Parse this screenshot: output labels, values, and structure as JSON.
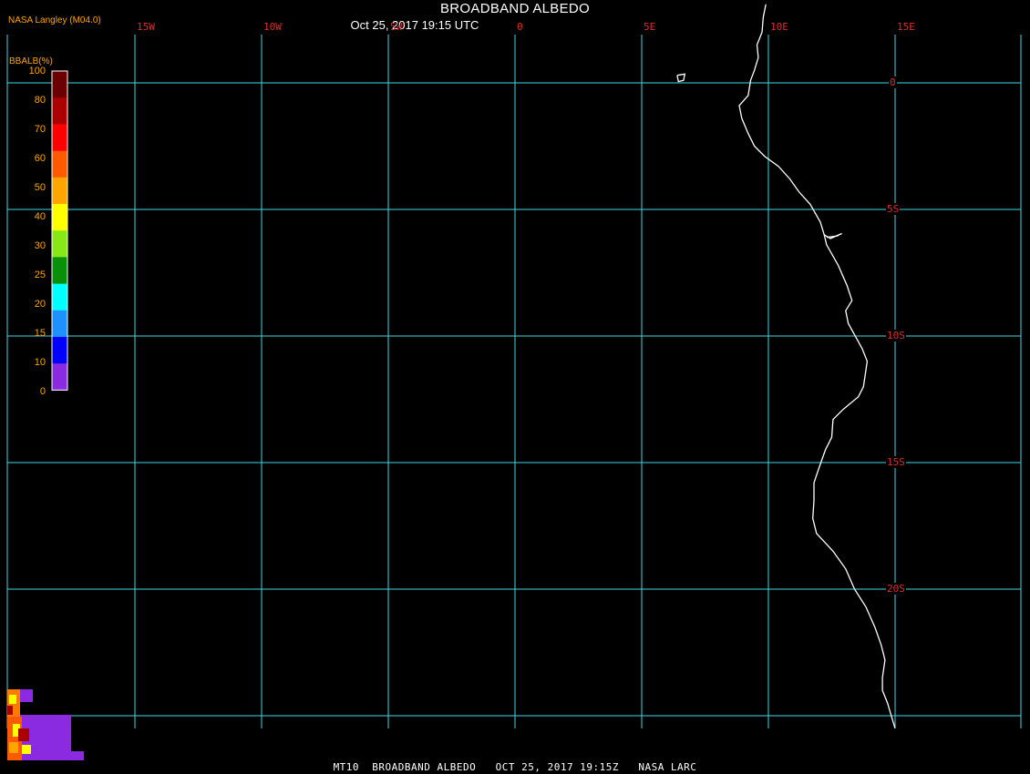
{
  "header": {
    "title": "BROADBAND ALBEDO",
    "datetime": "Oct 25, 2017 19:15 UTC",
    "credit": "NASA Langley (M04.0)"
  },
  "colorbar": {
    "title": "BBALB(%)",
    "ticks": [
      "100",
      "80",
      "70",
      "60",
      "50",
      "40",
      "30",
      "25",
      "20",
      "15",
      "10",
      "0"
    ],
    "colors": [
      "#6a0000",
      "#aa0000",
      "#ff0000",
      "#ff5a00",
      "#ffa500",
      "#ffff00",
      "#88e817",
      "#0a8f0a",
      "#00ffff",
      "#1e90ff",
      "#0000ff",
      "#8a2be2"
    ]
  },
  "grid": {
    "longitudes": [
      {
        "label": "15W",
        "lon": -15
      },
      {
        "label": "10W",
        "lon": -10
      },
      {
        "label": "5W",
        "lon": -5
      },
      {
        "label": "0",
        "lon": 0
      },
      {
        "label": "5E",
        "lon": 5
      },
      {
        "label": "10E",
        "lon": 10
      },
      {
        "label": "15E",
        "lon": 15
      }
    ],
    "latitudes": [
      {
        "label": "0",
        "lat": 0
      },
      {
        "label": "5S",
        "lat": -5
      },
      {
        "label": "10S",
        "lat": -10
      },
      {
        "label": "15S",
        "lat": -15
      },
      {
        "label": "20S",
        "lat": -20
      },
      {
        "label": "",
        "lat": -25
      }
    ],
    "line_color": "#40d8e0",
    "label_color": "#e02a2a"
  },
  "map": {
    "coastline_color": "#ffffff",
    "coastline": [
      [
        9.9,
        3.1
      ],
      [
        9.8,
        2.6
      ],
      [
        9.75,
        2.0
      ],
      [
        9.55,
        1.5
      ],
      [
        9.6,
        1.0
      ],
      [
        9.45,
        0.5
      ],
      [
        9.3,
        0.1
      ],
      [
        9.2,
        -0.5
      ],
      [
        8.85,
        -0.9
      ],
      [
        8.95,
        -1.4
      ],
      [
        9.2,
        -2.0
      ],
      [
        9.45,
        -2.5
      ],
      [
        9.85,
        -2.9
      ],
      [
        10.4,
        -3.3
      ],
      [
        10.85,
        -3.8
      ],
      [
        11.2,
        -4.3
      ],
      [
        11.65,
        -4.8
      ],
      [
        12.05,
        -5.5
      ],
      [
        12.2,
        -6.0
      ],
      [
        12.3,
        -6.4
      ],
      [
        12.75,
        -7.2
      ],
      [
        13.1,
        -8.0
      ],
      [
        13.3,
        -8.6
      ],
      [
        13.05,
        -9.0
      ],
      [
        13.15,
        -9.5
      ],
      [
        13.7,
        -10.5
      ],
      [
        13.9,
        -11.0
      ],
      [
        13.75,
        -12.0
      ],
      [
        13.55,
        -12.4
      ],
      [
        12.95,
        -12.9
      ],
      [
        12.55,
        -13.3
      ],
      [
        12.5,
        -14.0
      ],
      [
        12.25,
        -14.5
      ],
      [
        12.0,
        -15.2
      ],
      [
        11.8,
        -15.8
      ],
      [
        11.8,
        -16.5
      ],
      [
        11.75,
        -17.2
      ],
      [
        11.9,
        -17.8
      ],
      [
        12.55,
        -18.5
      ],
      [
        13.05,
        -19.2
      ],
      [
        13.4,
        -20.0
      ],
      [
        13.85,
        -20.7
      ],
      [
        14.2,
        -21.5
      ],
      [
        14.45,
        -22.2
      ],
      [
        14.6,
        -22.8
      ],
      [
        14.5,
        -23.5
      ],
      [
        14.5,
        -24.0
      ],
      [
        14.7,
        -24.5
      ],
      [
        14.85,
        -25.0
      ],
      [
        15.0,
        -25.5
      ]
    ],
    "islands": [
      [
        [
          6.4,
          0.3
        ],
        [
          6.7,
          0.35
        ],
        [
          6.65,
          0.1
        ],
        [
          6.45,
          0.05
        ],
        [
          6.4,
          0.3
        ]
      ]
    ],
    "inlet": [
      [
        12.2,
        -6.0
      ],
      [
        12.45,
        -6.15
      ],
      [
        12.9,
        -5.95
      ],
      [
        12.7,
        -6.05
      ],
      [
        12.3,
        -6.1
      ]
    ]
  },
  "footer": {
    "text": "MT10  BROADBAND ALBEDO   OCT 25, 2017 19:15Z   NASA LARC"
  }
}
